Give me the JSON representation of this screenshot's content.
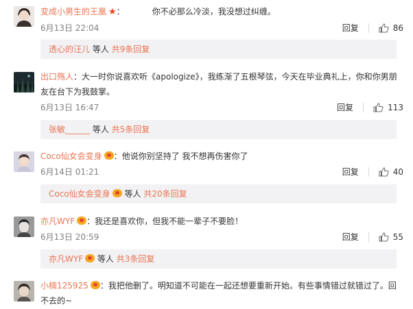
{
  "comments": [
    {
      "author": "变成小男生的王凰",
      "badge": "star",
      "text": "你不必那么冷淡，我没想过纠缠。",
      "time": "6月13日 22:04",
      "reply_label": "回复",
      "likes": "86",
      "replies": {
        "name": "透心的汪儿",
        "middle": " 等人 ",
        "count": "共9条回复"
      }
    },
    {
      "author": "出口殇人",
      "badge": "none",
      "text": "大一时你说喜欢听《apologize》，我练渐了五根琴弦，今天在毕业典礼上，你和你男朋友在台下为我鼓掌。",
      "time": "6月13日 16:47",
      "reply_label": "回复",
      "likes": "113",
      "replies": {
        "name": "张敏______",
        "middle": " 等人 ",
        "count": "共5条回复"
      }
    },
    {
      "author": "Coco仙女会变身",
      "badge": "vip",
      "text": "他说你别坚持了 我不想再伤害你了",
      "time": "6月14日 01:21",
      "reply_label": "回复",
      "likes": "40",
      "replies": {
        "name": "Coco仙女会变身",
        "middle": " 等人 ",
        "count": "共20条回复"
      }
    },
    {
      "author": "亦凡WYF",
      "badge": "vip",
      "text": "我还是喜欢你，但我不能一辈子不要脸！",
      "time": "6月13日 20:59",
      "reply_label": "回复",
      "likes": "55",
      "replies": {
        "name": "亦凡WYF",
        "middle": " 等人 ",
        "count": "共3条回复"
      }
    },
    {
      "author": "小楠125925",
      "badge": "vip",
      "text": "我把他删了。明知道不可能在一起还想要重新开始。有些事情错过就错过了。回不去的~"
    }
  ],
  "colors": {
    "author": "#eb7350",
    "reply_bg": "#f2f2f5",
    "meta": "#808080"
  },
  "icons": {
    "like": "thumbs-up-icon",
    "vip": "vip-badge-icon",
    "star": "star-badge-icon"
  }
}
